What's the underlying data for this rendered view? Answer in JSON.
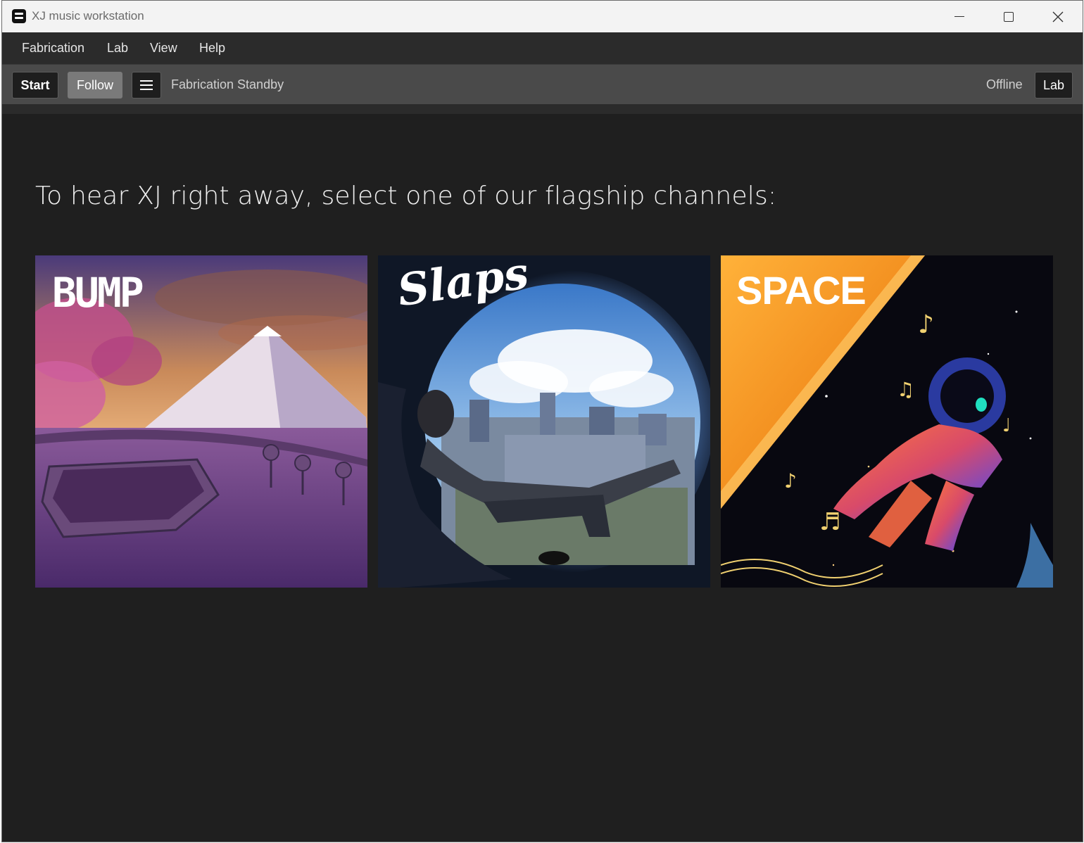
{
  "window": {
    "title": "XJ music workstation"
  },
  "menubar": {
    "items": [
      "Fabrication",
      "Lab",
      "View",
      "Help"
    ]
  },
  "toolbar": {
    "start_label": "Start",
    "follow_label": "Follow",
    "status": "Fabrication Standby",
    "connection_status": "Offline",
    "lab_label": "Lab"
  },
  "main": {
    "headline": "To hear XJ right away, select one of our flagship channels:",
    "channels": [
      {
        "logo": "BUMP",
        "art": "anime mountain lounge at sunset"
      },
      {
        "logo": "Slaps",
        "art": "person relaxing in circular window over city"
      },
      {
        "logo": "SPACE",
        "art": "astronaut floating among musical notes"
      }
    ]
  },
  "colors": {
    "background": "#1f1f1f",
    "menubar": "#2b2b2b",
    "toolbar": "#4a4a4a",
    "follow_button": "#7a7a7a",
    "titlebar": "#f3f3f3"
  }
}
